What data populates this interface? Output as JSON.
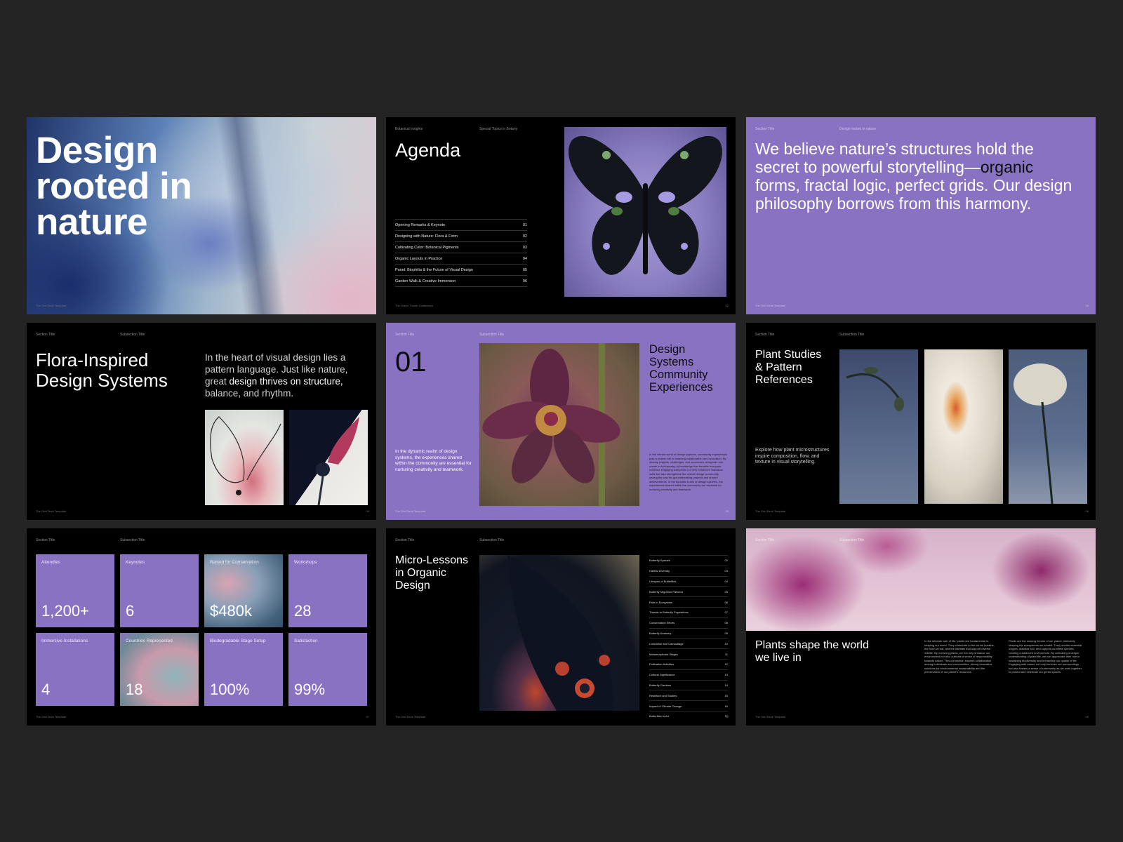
{
  "slides": {
    "s1": {
      "title_lines": [
        "Design",
        "rooted in",
        "nature"
      ],
      "footer_left": "The Grid Deck Template"
    },
    "s2": {
      "label_left": "Botanical Insights",
      "label_right": "Special Topics in Botany",
      "title": "Agenda",
      "items": [
        {
          "label": "Opening Remarks & Keynote",
          "num": "01"
        },
        {
          "label": "Designing with Nature: Flora & Form",
          "num": "02"
        },
        {
          "label": "Cultivating Color: Botanical Pigments",
          "num": "03"
        },
        {
          "label": "Organic Layouts in Practice",
          "num": "04"
        },
        {
          "label": "Panel: Biophilia & the Future of Visual Design",
          "num": "05"
        },
        {
          "label": "Garden Walk & Creative Immersion",
          "num": "06"
        }
      ],
      "footer_left": "The Green Thumb Conference",
      "footer_right": "02"
    },
    "s3": {
      "label_left": "Section Title",
      "label_right": "Design rooted in nature",
      "quote_start": "We believe nature’s structures hold the secret to powerful storytelling—",
      "quote_dark": "organic",
      "quote_end": " forms, fractal logic, perfect grids. Our design philosophy borrows from this harmony.",
      "footer_left": "The Grid Deck Template",
      "footer_right": "03"
    },
    "s4": {
      "label_left": "Section Title",
      "label_right": "Subsection Title",
      "title_lines": [
        "Flora-Inspired",
        "Design Systems"
      ],
      "body_start": "In the heart of visual design lies a pattern language. Just like nature, great ",
      "body_bold": "design thrives on structure,",
      "body_end": " balance, and rhythm.",
      "footer_left": "The Grid Deck Template",
      "footer_right": "04"
    },
    "s5": {
      "label_left": "Section Title",
      "label_right": "Subsection Title",
      "number": "01",
      "left_text": "In the dynamic realm of design systems, the experiences shared within the community are essential for nurturing creativity and teamwork.",
      "side_title_lines": [
        "Design",
        "Systems",
        "Community",
        "Experiences"
      ],
      "side_body": "In the vibrant world of design systems, community experiences play a pivotal role in fostering collaboration and innovation. By sharing insights, challenges, and successes, designers can create a rich tapestry of knowledge that benefits everyone involved. Engaging with peers not only enhances individual skills but also strengthens the overall design community, paving the way for groundbreaking projects and shared achievements. In the dynamic realm of design systems, the experiences shared within the community are essential for nurturing creativity and teamwork.",
      "footer_left": "The Grid Deck Template",
      "footer_right": "05"
    },
    "s6": {
      "label_left": "Section Title",
      "label_right": "Subsection Title",
      "title_lines": [
        "Plant Studies",
        "& Pattern",
        "References"
      ],
      "caption": "Explore how plant microstructures inspire composition, flow, and texture in visual storytelling.",
      "footer_left": "The Grid Deck Template",
      "footer_right": "06"
    },
    "s7": {
      "label_left": "Section Title",
      "label_right": "Subsection Title",
      "stats": [
        {
          "label": "Attendies",
          "value": "1,200+"
        },
        {
          "label": "Keynotes",
          "value": "6"
        },
        {
          "label": "Raised for Conservation",
          "value": "$480k"
        },
        {
          "label": "Workshops",
          "value": "28"
        },
        {
          "label": "Immersive Installations",
          "value": "4"
        },
        {
          "label": "Countries Represented",
          "value": "18"
        },
        {
          "label": "Biodegradable Stage Setup",
          "value": "100%"
        },
        {
          "label": "Satisfaction",
          "value": "99%"
        }
      ],
      "footer_left": "The Grid Deck Template",
      "footer_right": "07"
    },
    "s8": {
      "label_left": "Section Title",
      "label_right": "Subsection Title",
      "title_lines": [
        "Micro-Lessons",
        "in Organic",
        "Design"
      ],
      "items": [
        {
          "label": "Butterfly Species",
          "num": "02"
        },
        {
          "label": "Habitat Diversity",
          "num": "03"
        },
        {
          "label": "Lifespan of Butterflies",
          "num": "04"
        },
        {
          "label": "Butterfly Migration Patterns",
          "num": "05"
        },
        {
          "label": "Role in Ecosystem",
          "num": "06"
        },
        {
          "label": "Threats to Butterfly Populations",
          "num": "07"
        },
        {
          "label": "Conservation Efforts",
          "num": "08"
        },
        {
          "label": "Butterfly Anatomy",
          "num": "09"
        },
        {
          "label": "Coloration and Camouflage",
          "num": "10"
        },
        {
          "label": "Metamorphosis Stages",
          "num": "11"
        },
        {
          "label": "Pollination Activities",
          "num": "12"
        },
        {
          "label": "Cultural Significance",
          "num": "13"
        },
        {
          "label": "Butterfly Gardens",
          "num": "14"
        },
        {
          "label": "Research and Studies",
          "num": "15"
        },
        {
          "label": "Impact of Climate Change",
          "num": "16"
        },
        {
          "label": "Butterflies in Art",
          "num": "17"
        }
      ],
      "footer_left": "The Grid Deck Template",
      "footer_right": "08"
    },
    "s9": {
      "label_left": "Section Title",
      "label_right": "Subsection Title",
      "title_lines": [
        "Plants shape the world",
        "we live in"
      ],
      "col1": "In the intricate web of life, plants are fundamental in shaping our world. They contribute to the air we breathe, the food we eat, and the habitats that support diverse wildlife. By nurturing plants, we not only enhance our environment but also cultivate a sense of responsibility towards nature. This connection inspires collaboration among individuals and communities, driving innovative solutions for environmental sustainability and the preservation of our planet's resources.",
      "col2": "Plants are the unsung heroes of our planet, intricately shaping the ecosystems we inhabit. They provide essential oxygen, stabilize soil, and support countless species, creating a balanced environment. By cultivating a deeper understanding of plant life, we can appreciate their role in sustaining biodiversity and enhancing our quality of life. Engaging with nature not only enriches our surroundings but also fosters a sense of community as we work together to protect and celebrate our green spaces.",
      "footer_left": "The Grid Deck Template",
      "footer_right": "09"
    }
  }
}
